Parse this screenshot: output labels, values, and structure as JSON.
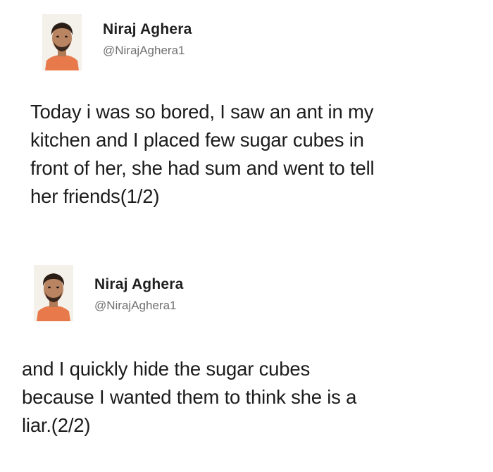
{
  "tweets": [
    {
      "author": {
        "display_name": "Niraj Aghera",
        "handle": "@NirajAghera1",
        "avatar_icon": "profile-photo-icon"
      },
      "text_lines": [
        "Today i was so bored, I saw an ant in my",
        "kitchen and I placed few sugar cubes in",
        "front of her, she had sum and went to tell",
        "her friends(1/2)"
      ]
    },
    {
      "author": {
        "display_name": "Niraj Aghera",
        "handle": "@NirajAghera1",
        "avatar_icon": "profile-photo-icon"
      },
      "text_lines": [
        "and I quickly hide the sugar cubes",
        "because I wanted them to think she is a",
        "liar.(2/2)"
      ]
    }
  ],
  "colors": {
    "text": "#1c1c1c",
    "handle": "#707070",
    "background": "#ffffff",
    "shirt": "#e8794a",
    "skin": "#b98461",
    "hair": "#2a1d16"
  }
}
